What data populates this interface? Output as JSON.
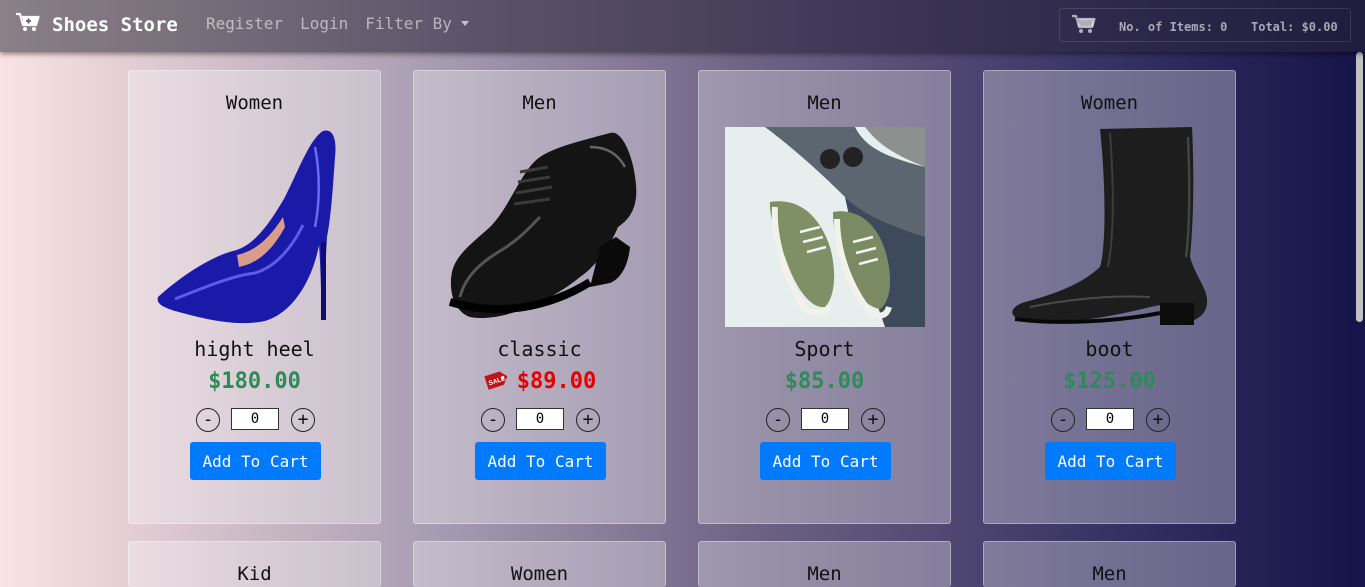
{
  "brand": {
    "title": "Shoes Store"
  },
  "nav": {
    "register": "Register",
    "login": "Login",
    "filter": "Filter By"
  },
  "cart": {
    "items_text": "No. of Items: 0",
    "total_text": "Total: $0.00"
  },
  "products": [
    {
      "category": "Women",
      "name": "hight heel",
      "price": "$180.00",
      "qty": "0",
      "add_label": "Add To Cart",
      "on_sale": false
    },
    {
      "category": "Men",
      "name": "classic",
      "price": "$89.00",
      "qty": "0",
      "add_label": "Add To Cart",
      "on_sale": true,
      "sale_tag": "SALE"
    },
    {
      "category": "Men",
      "name": "Sport",
      "price": "$85.00",
      "qty": "0",
      "add_label": "Add To Cart",
      "on_sale": false
    },
    {
      "category": "Women",
      "name": "boot",
      "price": "$125.00",
      "qty": "0",
      "add_label": "Add To Cart",
      "on_sale": false
    }
  ],
  "products_row2": [
    {
      "category": "Kid"
    },
    {
      "category": "Women"
    },
    {
      "category": "Men"
    },
    {
      "category": "Men"
    }
  ],
  "controls": {
    "minus": "-",
    "plus": "+"
  },
  "colors": {
    "price_regular": "#2e8b57",
    "price_sale": "#e60000",
    "button_primary": "#007bff"
  },
  "icons": {
    "brand": "cart-icon",
    "cart": "shopping-cart-icon",
    "sale": "sale-tag-icon"
  }
}
